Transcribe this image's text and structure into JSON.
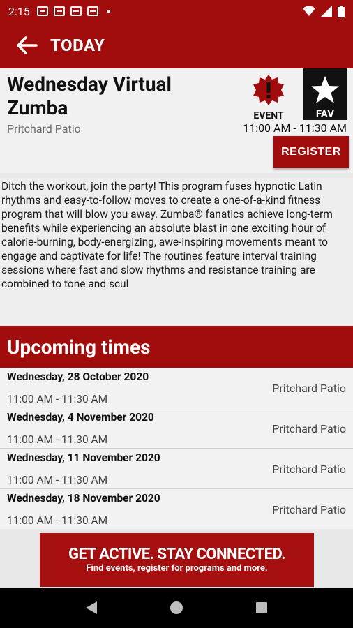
{
  "status_bar": {
    "time": "2:15"
  },
  "app_bar": {
    "title": "TODAY"
  },
  "event": {
    "title": "Wednesday Virtual Zumba",
    "location": "Pritchard Patio",
    "badge_label": "EVENT",
    "fav_label": "FAV",
    "time": "11:00 AM - 11:30 AM",
    "register_label": "REGISTER",
    "description": "Ditch the workout, join the party! This program fuses hypnotic Latin rhythms and easy-to-follow moves to create a one-of-a-kind fitness program that will blow you away. Zumba® fanatics achieve long-term benefits while experiencing an absolute blast in one exciting hour of calorie-burning, body-energizing, awe-inspiring movements meant to engage and captivate for life! The routines feature interval training sessions where fast and slow rhythms and resistance training are combined to tone and scul"
  },
  "upcoming": {
    "heading": "Upcoming times",
    "items": [
      {
        "date": "Wednesday, 28 October 2020",
        "hours": "11:00 AM - 11:30 AM",
        "location": "Pritchard Patio"
      },
      {
        "date": "Wednesday, 4 November 2020",
        "hours": "11:00 AM - 11:30 AM",
        "location": "Pritchard Patio"
      },
      {
        "date": "Wednesday, 11 November 2020",
        "hours": "11:00 AM - 11:30 AM",
        "location": "Pritchard Patio"
      },
      {
        "date": "Wednesday, 18 November 2020",
        "hours": "11:00 AM - 11:30 AM",
        "location": "Pritchard Patio"
      }
    ]
  },
  "banner": {
    "headline": "GET ACTIVE. STAY CONNECTED.",
    "subline": "Find events, register for programs and more."
  },
  "colors": {
    "brand_red": "#a10c0c",
    "black": "#111111"
  }
}
